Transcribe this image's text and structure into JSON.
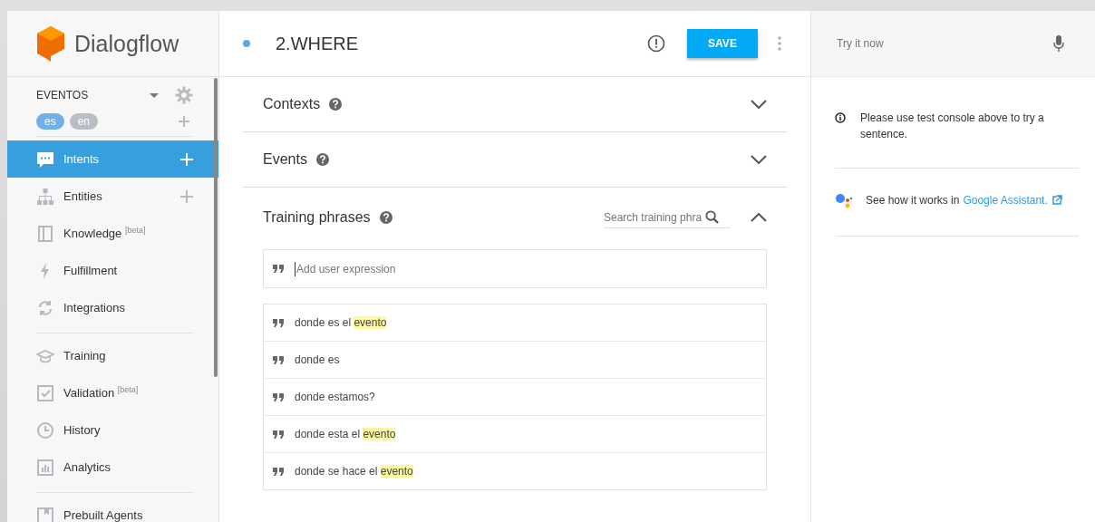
{
  "brand": {
    "name": "Dialogflow"
  },
  "agent": {
    "name": "EVENTOS",
    "languages": [
      {
        "code": "es",
        "selected": true
      },
      {
        "code": "en",
        "selected": false
      }
    ]
  },
  "sidebar": {
    "groups": [
      {
        "items": [
          {
            "label": "Intents",
            "kind": "intents",
            "selected": true,
            "add": true
          },
          {
            "label": "Entities",
            "kind": "entities",
            "selected": false,
            "add": true
          },
          {
            "label": "Knowledge $^{[beta]}$",
            "kind": "knowledge",
            "selected": false,
            "add": false
          },
          {
            "label": "Fulfillment",
            "kind": "fulfillment",
            "selected": false,
            "add": false
          },
          {
            "label": "Integrations",
            "kind": "integrations",
            "selected": false,
            "add": false
          }
        ]
      },
      {
        "items": [
          {
            "label": "Training",
            "kind": "training",
            "selected": false,
            "add": false
          },
          {
            "label": "Validation $^{[beta]}$",
            "kind": "validation",
            "selected": false,
            "add": false
          },
          {
            "label": "History",
            "kind": "history",
            "selected": false,
            "add": false
          },
          {
            "label": "Analytics",
            "kind": "analytics",
            "selected": false,
            "add": false
          }
        ]
      },
      {
        "items": [
          {
            "label": "Prebuilt Agents",
            "kind": "prebuilt",
            "selected": false,
            "add": false
          }
        ]
      }
    ]
  },
  "intent": {
    "title": "2.WHERE",
    "save": "SAVE"
  },
  "sections": [
    {
      "title": "Contexts",
      "expanded": false
    },
    {
      "title": "Events",
      "expanded": false
    },
    {
      "title": "Training phrases",
      "expanded": true,
      "search_placeholder": "Search training phra"
    }
  ],
  "training": {
    "input_placeholder": "Add user expression",
    "phrases": [
      {
        "segments": [
          {
            "text": "donde es el ",
            "highlighted": false
          },
          {
            "text": "evento",
            "highlighted": true
          }
        ]
      },
      {
        "segments": [
          {
            "text": "donde es",
            "highlighted": false
          }
        ]
      },
      {
        "segments": [
          {
            "text": "donde estamos?",
            "highlighted": false
          }
        ]
      },
      {
        "segments": [
          {
            "text": "donde esta el ",
            "highlighted": false
          },
          {
            "text": "evento",
            "highlighted": true
          }
        ]
      },
      {
        "segments": [
          {
            "text": "donde se hace el ",
            "highlighted": false
          },
          {
            "text": "evento",
            "highlighted": true
          }
        ]
      }
    ]
  },
  "console": {
    "placeholder": "Try it now",
    "notice": "Please use test console above to try a sentence.",
    "assistant_text": "See how it works in",
    "assistant_link": "Google Assistant."
  }
}
